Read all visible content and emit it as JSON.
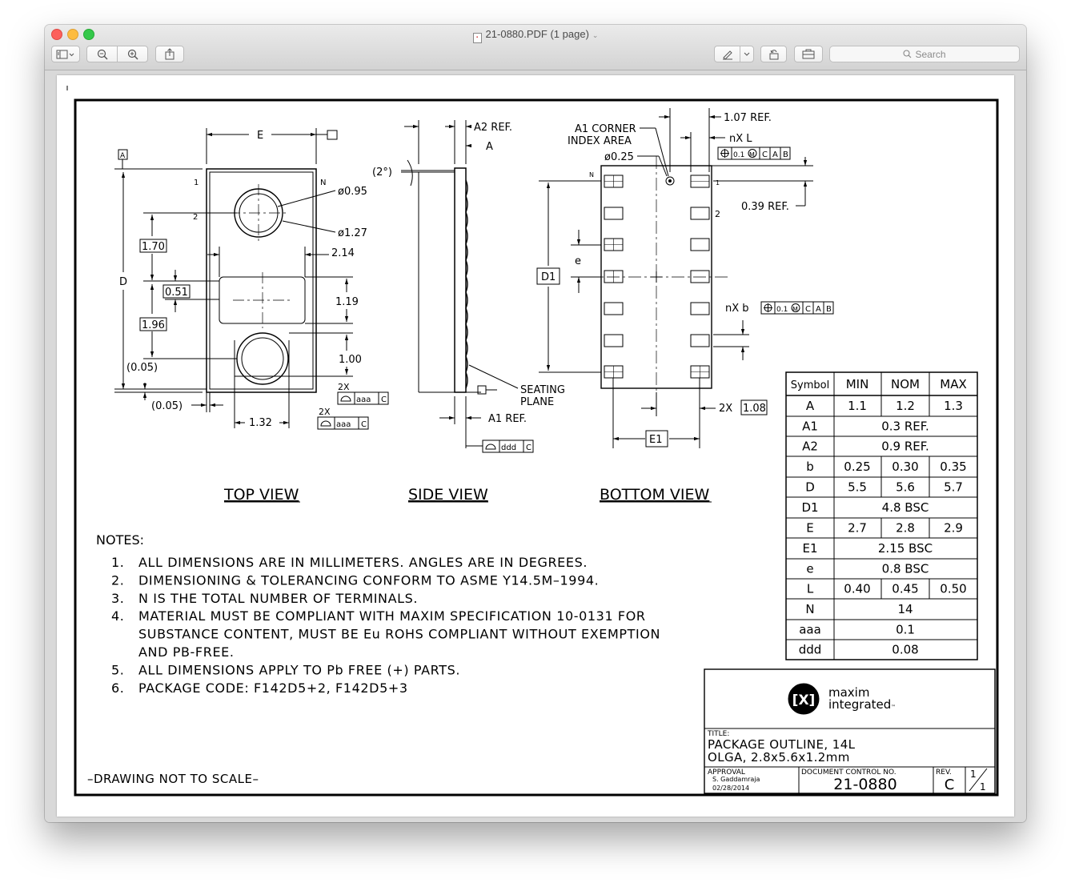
{
  "window": {
    "title": "21-0880.PDF (1 page)",
    "title_chevron": "⌄",
    "search_placeholder": "Search"
  },
  "drawing": {
    "views": {
      "top": "TOP VIEW",
      "side": "SIDE VIEW",
      "bottom": "BOTTOM VIEW"
    },
    "top_view": {
      "E": "E",
      "A": "A",
      "D": "D",
      "pin1": "1",
      "pin2": "2",
      "pinN": "N",
      "d095": "ø0.95",
      "d127": "ø1.27",
      "d214": "2.14",
      "d170": "1.70",
      "d051": "0.51",
      "d196": "1.96",
      "d119": "1.19",
      "d100": "1.00",
      "d005a": "(0.05)",
      "d005b": "(0.05)",
      "d132": "1.32",
      "x2a": "2X",
      "x2b": "2X",
      "aaa": "aaa",
      "C": "C"
    },
    "side_view": {
      "a2ref": "A2 REF.",
      "A": "A",
      "angle": "(2°)",
      "seating1": "SEATING",
      "seating2": "PLANE",
      "a1ref": "A1 REF.",
      "ddd": "ddd",
      "C": "C"
    },
    "bottom_view": {
      "corner1": "A1 CORNER",
      "corner2": "INDEX AREA",
      "d025": "ø0.25",
      "ref107": "1.07 REF.",
      "nxl": "nX L",
      "tol": "0.1",
      "M": "M",
      "C": "C",
      "A": "A",
      "B": "B",
      "ref039": "0.39 REF.",
      "pinN": "N",
      "pin1": "1",
      "pin2": "2",
      "e": "e",
      "D1": "D1",
      "nxb": "nX b",
      "x2": "2X",
      "d108": "1.08",
      "E1": "E1"
    },
    "notes_title": "NOTES:",
    "notes": [
      {
        "num": "1.",
        "lines": [
          "ALL DIMENSIONS ARE IN MILLIMETERS. ANGLES ARE IN DEGREES."
        ]
      },
      {
        "num": "2.",
        "lines": [
          "DIMENSIONING & TOLERANCING CONFORM TO ASME Y14.5M–1994."
        ]
      },
      {
        "num": "3.",
        "lines": [
          "N IS THE TOTAL NUMBER OF TERMINALS."
        ]
      },
      {
        "num": "4.",
        "lines": [
          "MATERIAL MUST BE COMPLIANT WITH MAXIM SPECIFICATION 10-0131 FOR",
          "SUBSTANCE CONTENT, MUST BE Eu ROHS COMPLIANT WITHOUT EXEMPTION",
          "AND PB-FREE."
        ]
      },
      {
        "num": "5.",
        "lines": [
          "ALL DIMENSIONS APPLY TO Pb FREE  (+)  PARTS."
        ]
      },
      {
        "num": "6.",
        "lines": [
          "PACKAGE CODE: F142D5+2, F142D5+3"
        ]
      }
    ],
    "not_to_scale": "–DRAWING NOT TO SCALE–",
    "table": {
      "headers": [
        "Symbol",
        "MIN",
        "NOM",
        "MAX"
      ],
      "rows": [
        {
          "sym": "A",
          "cells": [
            "1.1",
            "1.2",
            "1.3"
          ]
        },
        {
          "sym": "A1",
          "span": "0.3 REF."
        },
        {
          "sym": "A2",
          "span": "0.9 REF."
        },
        {
          "sym": "b",
          "cells": [
            "0.25",
            "0.30",
            "0.35"
          ]
        },
        {
          "sym": "D",
          "cells": [
            "5.5",
            "5.6",
            "5.7"
          ]
        },
        {
          "sym": "D1",
          "span": "4.8 BSC"
        },
        {
          "sym": "E",
          "cells": [
            "2.7",
            "2.8",
            "2.9"
          ]
        },
        {
          "sym": "E1",
          "span": "2.15 BSC"
        },
        {
          "sym": "e",
          "span": "0.8 BSC"
        },
        {
          "sym": "L",
          "cells": [
            "0.40",
            "0.45",
            "0.50"
          ]
        },
        {
          "sym": "N",
          "span": "14"
        },
        {
          "sym": "aaa",
          "span": "0.1"
        },
        {
          "sym": "ddd",
          "span": "0.08"
        }
      ]
    },
    "title_block": {
      "brand1": "maxim",
      "brand2": "integrated",
      "tm": "™",
      "title_label": "TITLE:",
      "title1": "PACKAGE OUTLINE, 14L",
      "title2": "OLGA, 2.8x5.6x1.2mm",
      "approval_label": "APPROVAL",
      "approver": "S. Gaddamraja",
      "date": "02/28/2014",
      "doc_label": "DOCUMENT CONTROL NO.",
      "doc_no": "21-0880",
      "rev_label": "REV.",
      "rev": "C",
      "sheet_num": "1",
      "sheet_den": "1"
    }
  }
}
